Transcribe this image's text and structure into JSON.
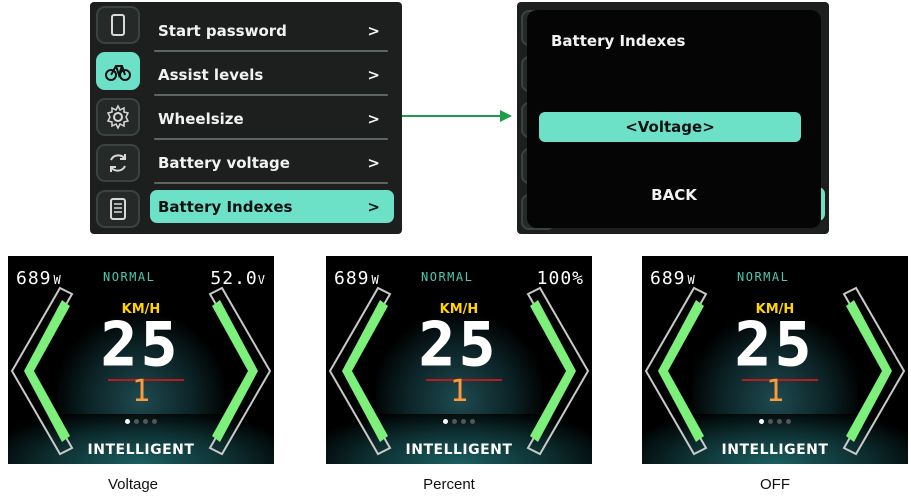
{
  "menu": {
    "icons": [
      "phone-icon",
      "bicycle-icon",
      "gear-icon",
      "refresh-icon",
      "document-icon"
    ],
    "items": [
      {
        "label": "Start password",
        "chevron": ">"
      },
      {
        "label": "Assist levels",
        "chevron": ">"
      },
      {
        "label": "Wheelsize",
        "chevron": ">"
      },
      {
        "label": "Battery voltage",
        "chevron": ">"
      },
      {
        "label": "Battery Indexes",
        "chevron": ">"
      }
    ],
    "active_index": 4
  },
  "arrow": {
    "color": "#1a9e4a"
  },
  "popup": {
    "title": "Battery Indexes",
    "selected_option": "<Voltage>",
    "back_label": "BACK"
  },
  "dashboards": [
    {
      "power": "689",
      "power_unit": "W",
      "mode": "NORMAL",
      "battery": "52.0",
      "battery_unit": "V",
      "unit": "KM/H",
      "speed": "25",
      "gear": "1",
      "assist_label": "INTELLIGENT",
      "caption": "Voltage"
    },
    {
      "power": "689",
      "power_unit": "W",
      "mode": "NORMAL",
      "battery": "100%",
      "battery_unit": "",
      "unit": "KM/H",
      "speed": "25",
      "gear": "1",
      "assist_label": "INTELLIGENT",
      "caption": "Percent"
    },
    {
      "power": "689",
      "power_unit": "W",
      "mode": "NORMAL",
      "battery": "",
      "battery_unit": "",
      "unit": "KM/H",
      "speed": "25",
      "gear": "1",
      "assist_label": "INTELLIGENT",
      "caption": "OFF"
    }
  ],
  "colors": {
    "accent": "#6de0c8",
    "chevron_green": "#7cf07a",
    "gear_orange": "#ff9a3c",
    "unit_yellow": "#ffd400"
  }
}
